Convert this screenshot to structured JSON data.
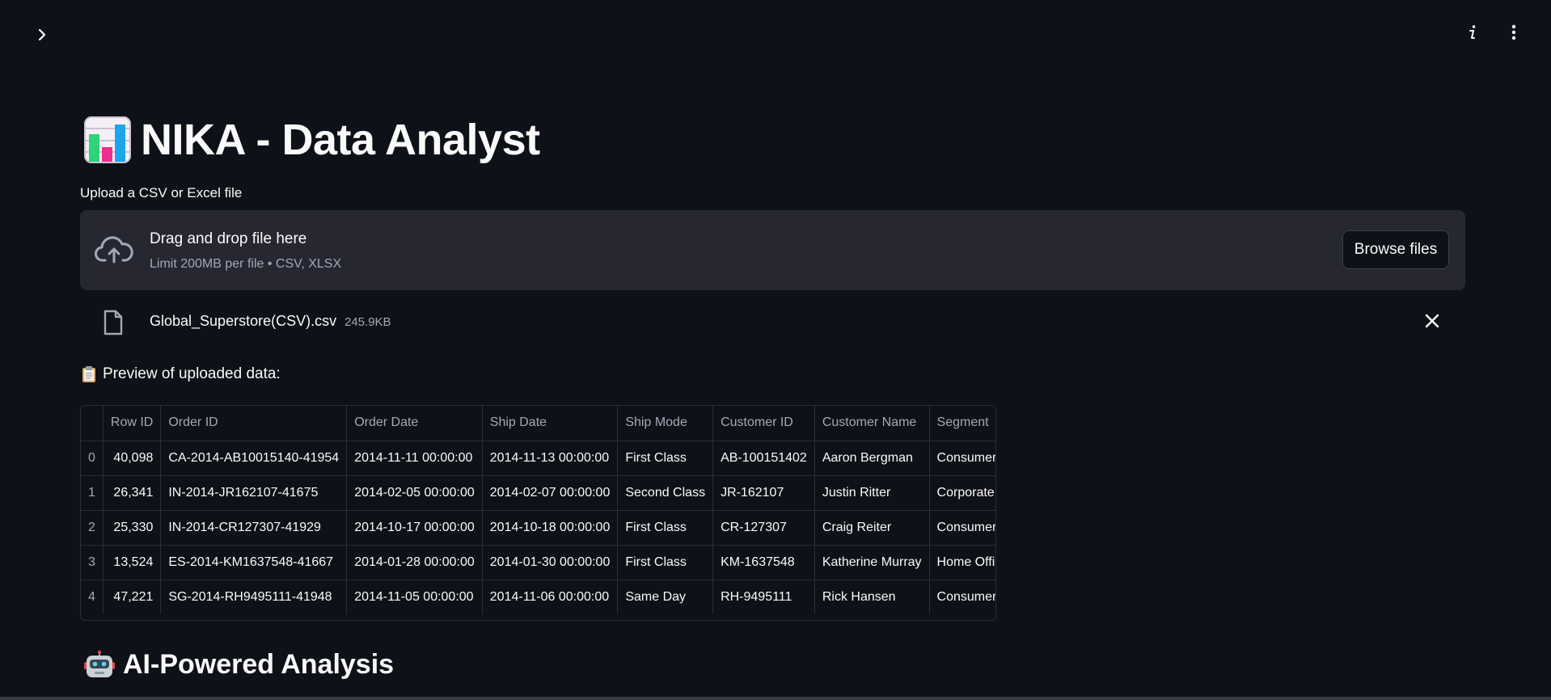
{
  "app": {
    "title": "NIKA - Data Analyst"
  },
  "uploader": {
    "label": "Upload a CSV or Excel file",
    "drag_text": "Drag and drop file here",
    "limit_text": "Limit 200MB per file • CSV, XLSX",
    "browse_label": "Browse files"
  },
  "uploaded_file": {
    "name": "Global_Superstore(CSV).csv",
    "size": "245.9KB"
  },
  "preview": {
    "heading": "Preview of uploaded data:",
    "columns": [
      "",
      "Row ID",
      "Order ID",
      "Order Date",
      "Ship Date",
      "Ship Mode",
      "Customer ID",
      "Customer Name",
      "Segment"
    ],
    "rows": [
      [
        "0",
        "40,098",
        "CA-2014-AB10015140-41954",
        "2014-11-11 00:00:00",
        "2014-11-13 00:00:00",
        "First Class",
        "AB-100151402",
        "Aaron Bergman",
        "Consumer"
      ],
      [
        "1",
        "26,341",
        "IN-2014-JR162107-41675",
        "2014-02-05 00:00:00",
        "2014-02-07 00:00:00",
        "Second Class",
        "JR-162107",
        "Justin Ritter",
        "Corporate"
      ],
      [
        "2",
        "25,330",
        "IN-2014-CR127307-41929",
        "2014-10-17 00:00:00",
        "2014-10-18 00:00:00",
        "First Class",
        "CR-127307",
        "Craig Reiter",
        "Consumer"
      ],
      [
        "3",
        "13,524",
        "ES-2014-KM1637548-41667",
        "2014-01-28 00:00:00",
        "2014-01-30 00:00:00",
        "First Class",
        "KM-1637548",
        "Katherine Murray",
        "Home Office"
      ],
      [
        "4",
        "47,221",
        "SG-2014-RH9495111-41948",
        "2014-11-05 00:00:00",
        "2014-11-06 00:00:00",
        "Same Day",
        "RH-9495111",
        "Rick Hansen",
        "Consumer"
      ]
    ]
  },
  "analysis": {
    "heading": "AI-Powered Analysis"
  },
  "icons": {
    "expand_sidebar": "chevron-right-icon",
    "info": "info-icon",
    "menu": "kebab-menu-icon",
    "upload": "cloud-upload-icon",
    "file": "file-icon",
    "remove": "close-icon",
    "title_emoji": "bar-chart-icon",
    "preview_emoji": "clipboard-icon",
    "analysis_emoji": "robot-icon"
  }
}
